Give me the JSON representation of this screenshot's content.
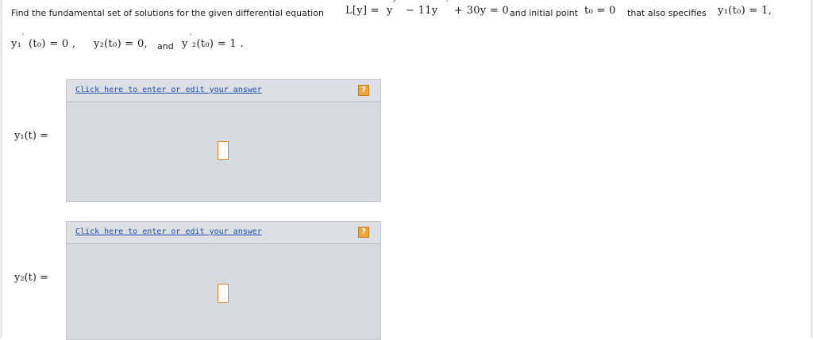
{
  "question": {
    "intro": "Find the fundamental set of solutions for the given differential equation",
    "equation_lhs": "L[y] =",
    "eq_y": "y",
    "eq_prime2": "″",
    "eq_minus": "− 11y",
    "eq_prime1": "′",
    "eq_rest": "+ 30y = 0",
    "mid_text": "and initial point",
    "initial_point": "t₀ = 0",
    "also_text": "that also specifies",
    "cond1": "y₁(t₀) = 1,",
    "cond2_y": "y₁",
    "cond2_prime": "′",
    "cond2_rest": "(t₀) = 0 ,",
    "cond3": "y₂(t₀) = 0,",
    "and_text": "and",
    "cond4_y": "y",
    "cond4_prime": "′",
    "cond4_rest": "₂(t₀) = 1 ."
  },
  "answers": [
    {
      "label": "y₁(t) =",
      "link_text": "Click here to enter or edit your answer",
      "help_icon": "question-mark-icon",
      "help_text": "?"
    },
    {
      "label": "y₂(t) =",
      "link_text": "Click here to enter or edit your answer",
      "help_icon": "question-mark-icon",
      "help_text": "?"
    }
  ],
  "colors": {
    "link": "#1f4fa8",
    "help": "#f0a53a",
    "slot_border": "#e08a2a",
    "panel": "#d6d9dd"
  }
}
